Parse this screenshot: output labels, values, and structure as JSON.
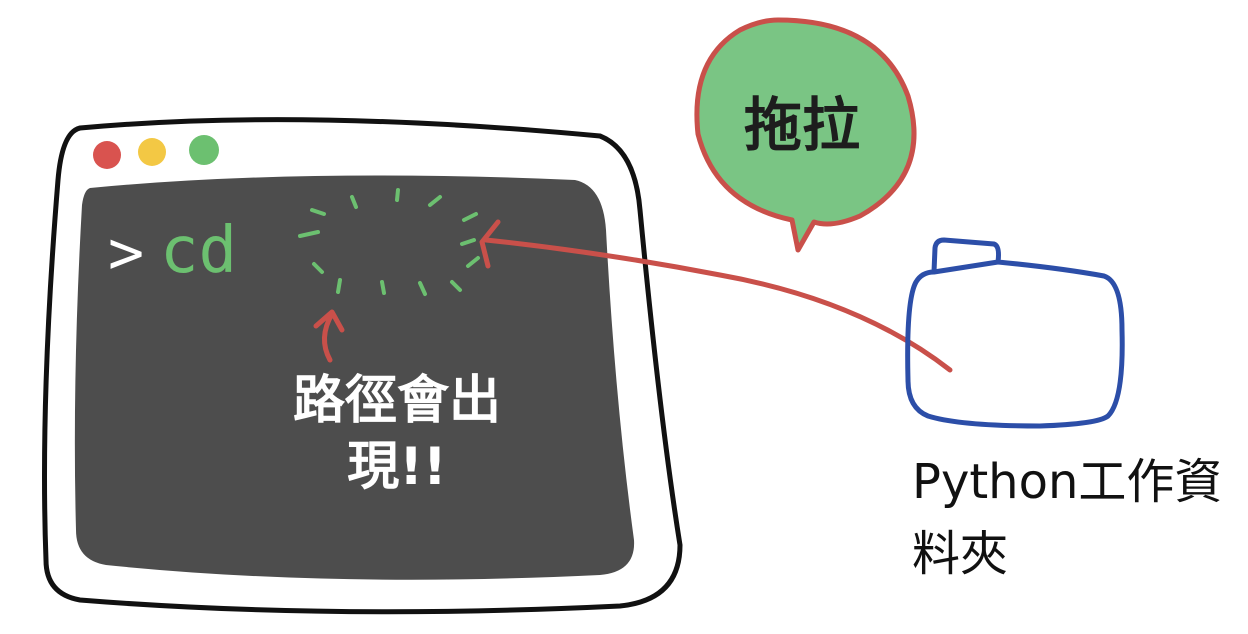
{
  "terminal": {
    "prompt": ">",
    "command": "cd",
    "note": "路徑會出現!!"
  },
  "bubble": {
    "text": "拖拉"
  },
  "folder": {
    "label": "Python工作資料夾"
  },
  "colors": {
    "window_border": "#111111",
    "terminal_bg": "#4d4d4d",
    "dot_red": "#d9534f",
    "dot_yellow": "#f3c844",
    "dot_green": "#6cc070",
    "arrow": "#c9504a",
    "bubble_fill": "#7ac584",
    "folder_stroke": "#2c4ea8"
  },
  "icons": [
    "window-red-dot",
    "window-yellow-dot",
    "window-green-dot",
    "folder-icon",
    "drag-arrow",
    "up-arrow"
  ]
}
